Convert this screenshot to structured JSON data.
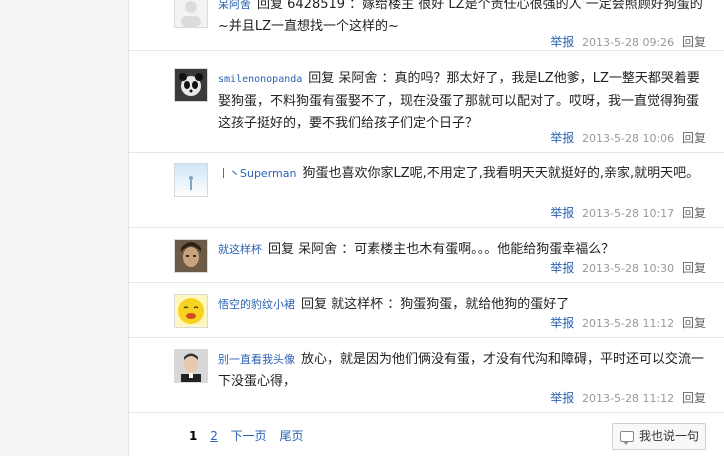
{
  "posts": [
    {
      "user": "呆阿舍",
      "text": "回复 6428519 ：嫁给楼主 很好 LZ是个责任心很强的人 一定会照顾好狗蛋的~并且LZ一直想找一个这样的~",
      "report": "举报",
      "time": "2013-5-28 09:26",
      "reply": "回复",
      "avatar": "blank-avatar"
    },
    {
      "user": "smilenonopanda",
      "text": "回复 呆阿舍 ：真的吗？那太好了，我是LZ他爹，LZ一整天都哭着要娶狗蛋，不料狗蛋有蛋娶不了，现在没蛋了那就可以配对了。哎呀，我一直觉得狗蛋这孩子挺好的，要不我们给孩子们定个日子？",
      "report": "举报",
      "time": "2013-5-28 10:06",
      "reply": "回复",
      "avatar": "panda-avatar"
    },
    {
      "user": "丨丶Superman",
      "text": "狗蛋也喜欢你家LZ呢,不用定了,我看明天天就挺好的,亲家,就明天吧。",
      "report": "举报",
      "time": "2013-5-28 10:17",
      "reply": "回复",
      "avatar": "sky-avatar"
    },
    {
      "user": "就这样杯",
      "text": "回复 呆阿舍 ：可素楼主也木有蛋啊。。。他能给狗蛋幸福么？",
      "report": "举报",
      "time": "2013-5-28 10:30",
      "reply": "回复",
      "avatar": "portrait-avatar"
    },
    {
      "user": "悟空的豹纹小裙",
      "text": "回复 就这样杯 ：狗蛋狗蛋，就给他狗的蛋好了",
      "report": "举报",
      "time": "2013-5-28 11:12",
      "reply": "回复",
      "avatar": "emoji-avatar"
    },
    {
      "user": "别一直看我头像",
      "text": "放心，就是因为他们俩没有蛋，才没有代沟和障碍，平时还可以交流一下没蛋心得，",
      "report": "举报",
      "time": "2013-5-28 11:12",
      "reply": "回复",
      "avatar": "man-avatar"
    }
  ],
  "pagination": {
    "current": "1",
    "page2": "2",
    "next": "下一页",
    "last": "尾页"
  },
  "say_button": "我也说一句",
  "colors": {
    "link": "#2a62b4",
    "time": "#999999"
  }
}
